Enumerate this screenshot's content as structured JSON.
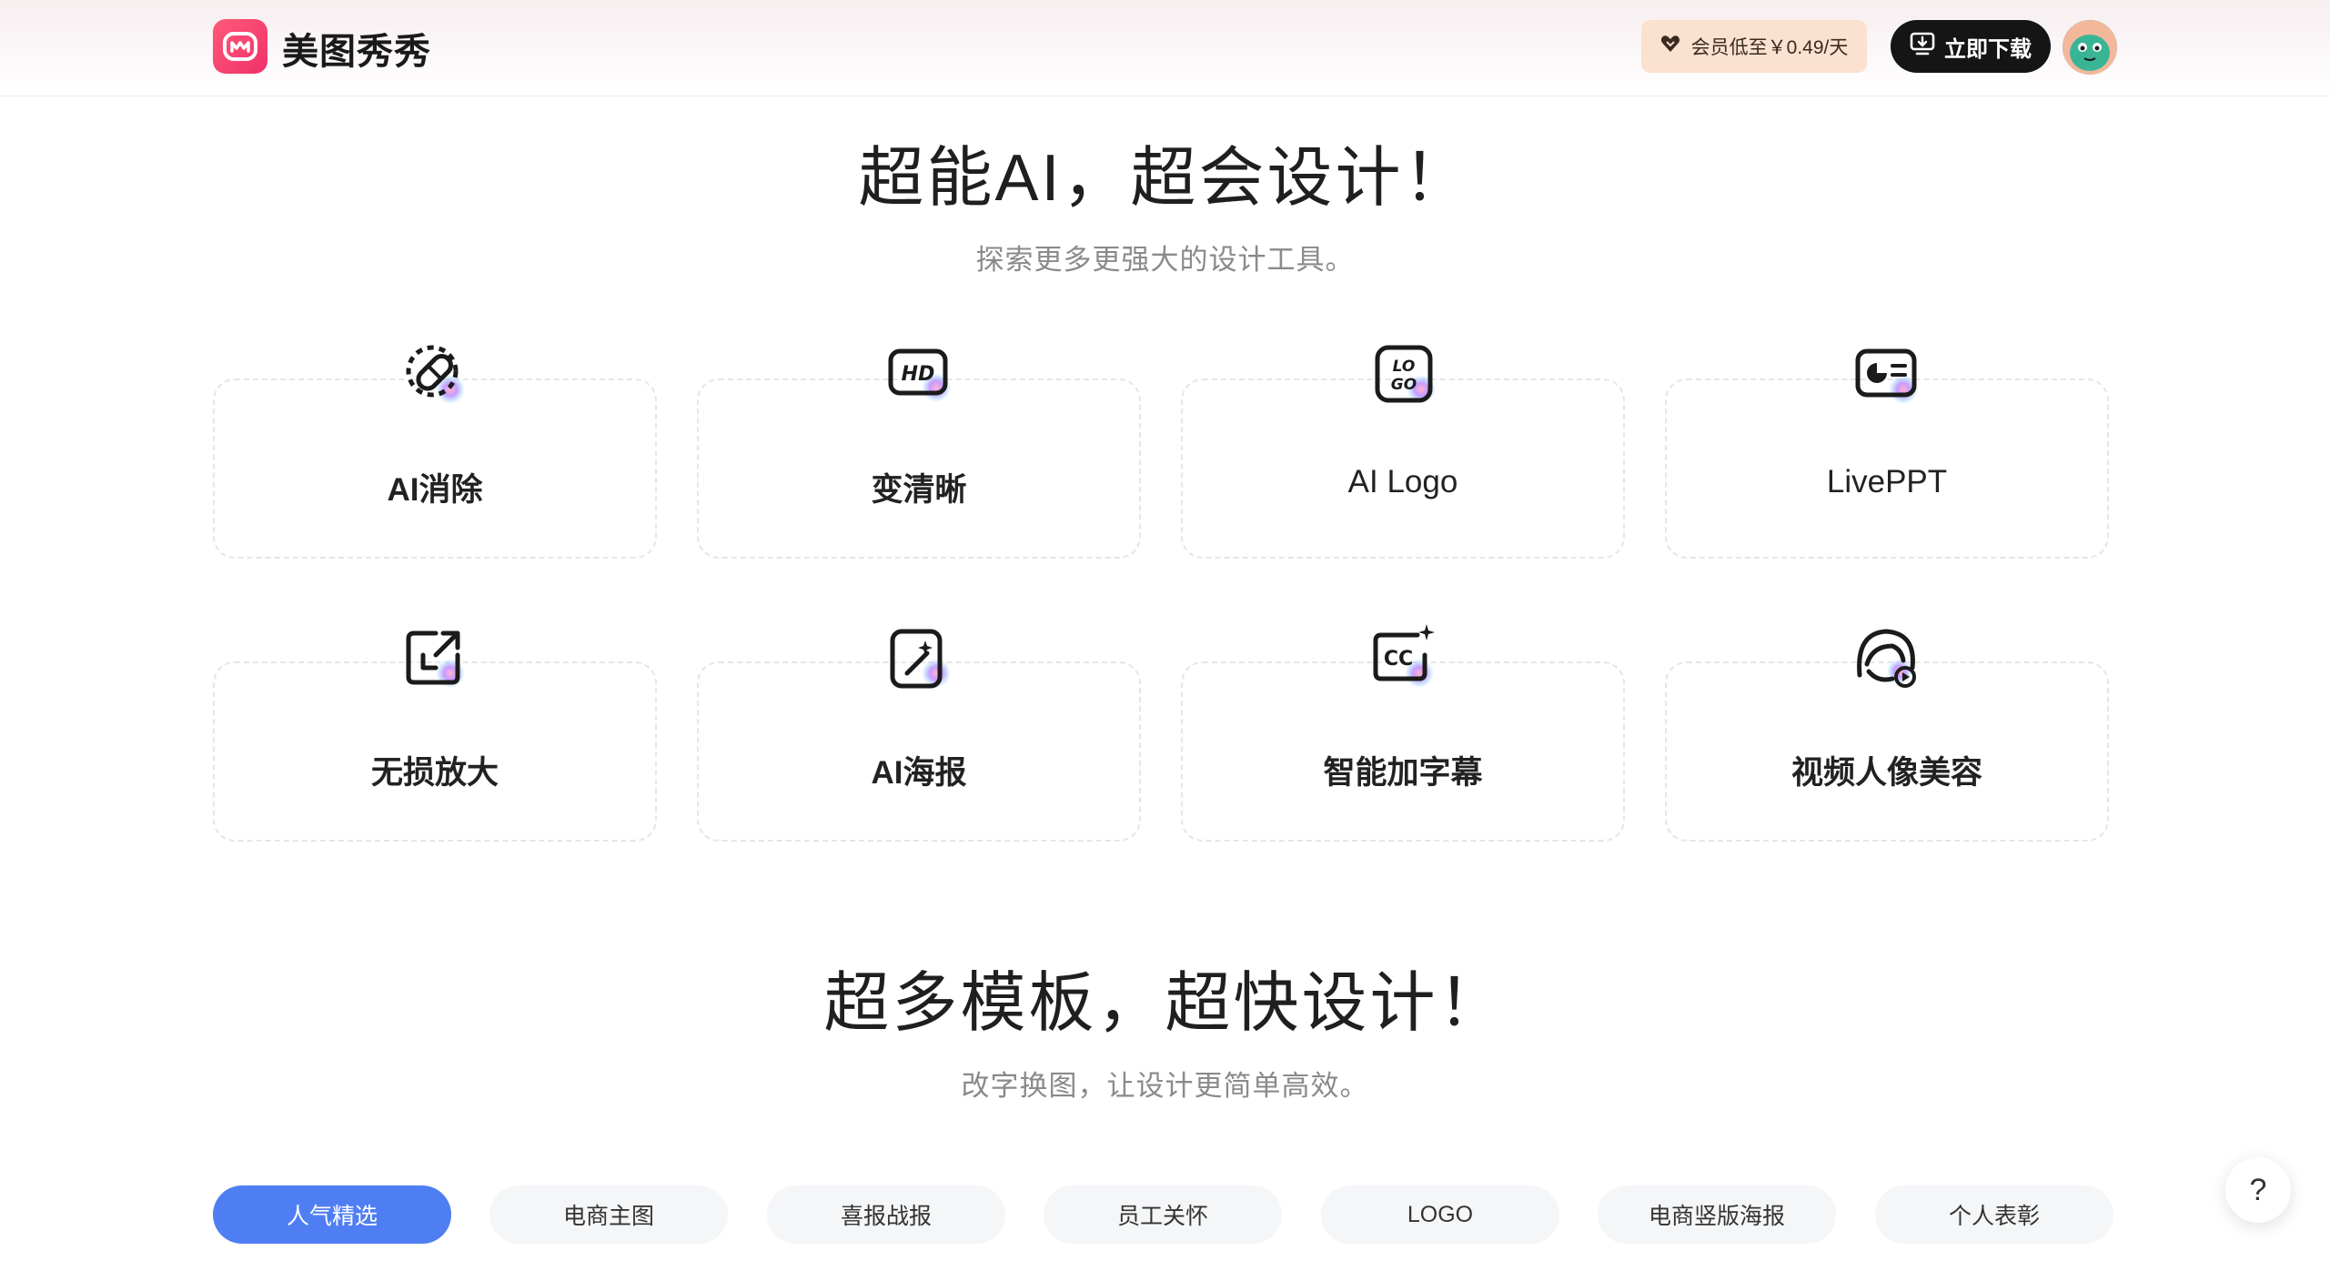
{
  "header": {
    "brand": "美图秀秀",
    "vip_label": "会员低至￥0.49/天",
    "download_label": "立即下载"
  },
  "ai_section": {
    "title": "超能AI，超会设计！",
    "subtitle": "探索更多更强大的设计工具。",
    "tools": [
      {
        "label": "AI消除",
        "icon": "eraser-bandage-icon"
      },
      {
        "label": "变清晰",
        "icon": "hd-icon"
      },
      {
        "label": "AI Logo",
        "icon": "logo-icon"
      },
      {
        "label": "LivePPT",
        "icon": "ppt-chart-icon"
      },
      {
        "label": "无损放大",
        "icon": "expand-image-icon"
      },
      {
        "label": "AI海报",
        "icon": "magic-poster-icon"
      },
      {
        "label": "智能加字幕",
        "icon": "subtitle-cc-icon"
      },
      {
        "label": "视频人像美容",
        "icon": "portrait-beauty-icon"
      }
    ]
  },
  "template_section": {
    "title": "超多模板，超快设计！",
    "subtitle": "改字换图，让设计更简单高效。",
    "tabs": [
      {
        "label": "人气精选",
        "active": true
      },
      {
        "label": "电商主图",
        "active": false
      },
      {
        "label": "喜报战报",
        "active": false
      },
      {
        "label": "员工关怀",
        "active": false
      },
      {
        "label": "LOGO",
        "active": false
      },
      {
        "label": "电商竖版海报",
        "active": false
      },
      {
        "label": "个人表彰",
        "active": false
      }
    ]
  },
  "help": {
    "label": "?"
  },
  "colors": {
    "brand": "#f0306a",
    "accent_tab": "#4f7ef3",
    "vip_bg": "#fbe1cf",
    "download_bg": "#151515"
  }
}
